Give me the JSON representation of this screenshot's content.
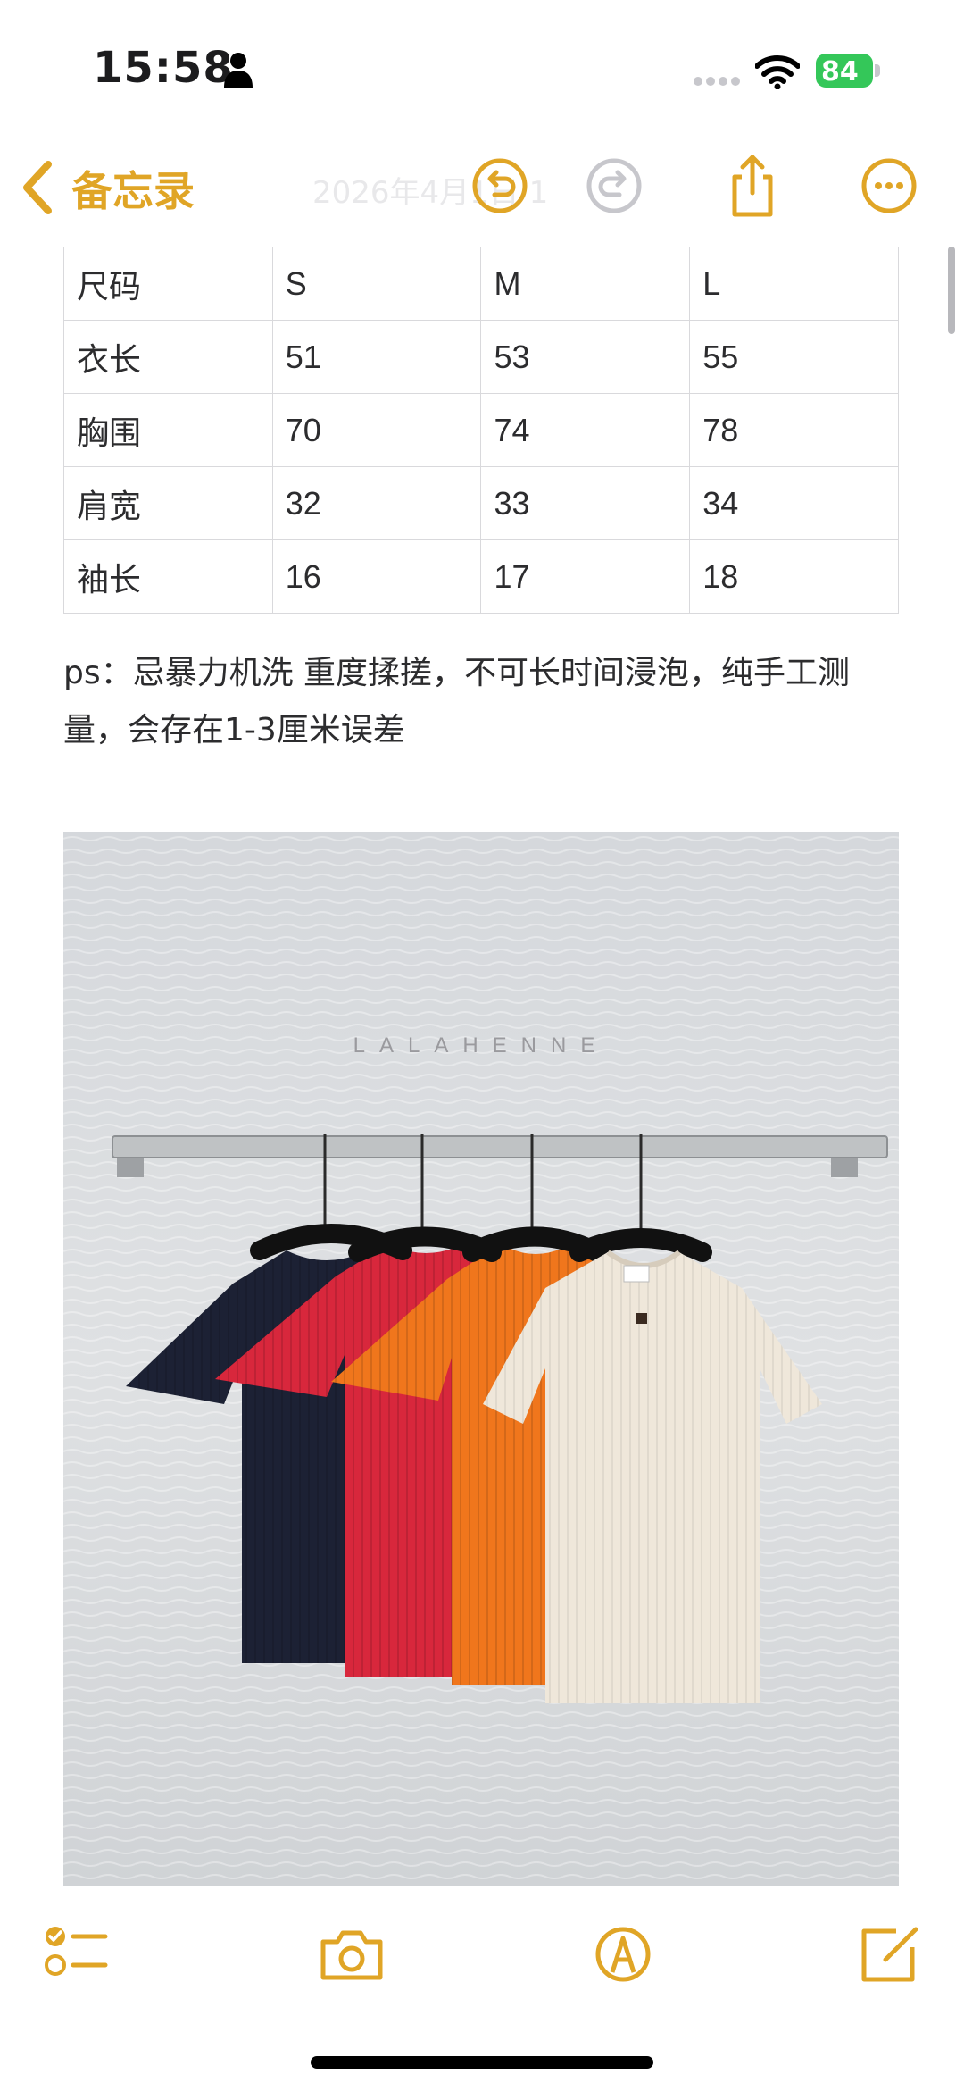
{
  "status": {
    "time": "15:58",
    "battery": "84"
  },
  "nav": {
    "back_label": "备忘录",
    "faded_date": "2026年4月1日 1"
  },
  "table": {
    "rows": [
      [
        "尺码",
        "S",
        "M",
        "L"
      ],
      [
        "衣长",
        "51",
        "53",
        "55"
      ],
      [
        "胸围",
        "70",
        "74",
        "78"
      ],
      [
        "肩宽",
        "32",
        "33",
        "34"
      ],
      [
        "袖长",
        "16",
        "17",
        "18"
      ]
    ]
  },
  "note": {
    "ps": "ps：忌暴力机洗 重度揉搓，不可长时间浸泡，纯手工测量，会存在1-3厘米误差"
  },
  "photo": {
    "watermark": "LALAHENNE",
    "shirt_colors": [
      "#1c2134",
      "#d8273c",
      "#f0761c",
      "#efe7da"
    ]
  },
  "colors": {
    "accent": "#e0a526"
  }
}
